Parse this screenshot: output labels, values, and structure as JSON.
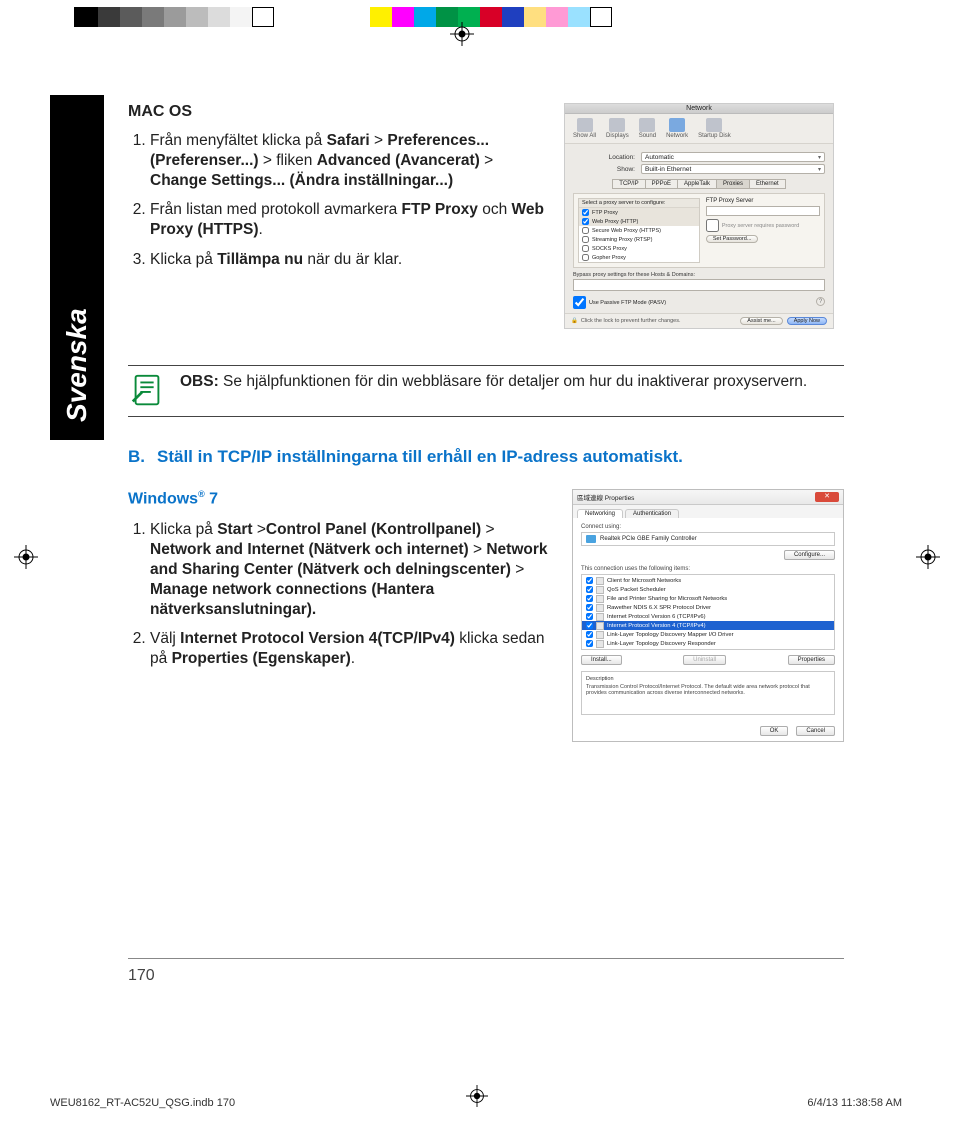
{
  "sidebar": {
    "language": "Svenska"
  },
  "macSection": {
    "heading": "MAC OS",
    "step1_a": "Från menyfältet klicka på ",
    "step1_b1": "Safari",
    "step1_gt1": " > ",
    "step1_b2": "Preferences... (Preferenser...)",
    "step1_gt2": " > fliken ",
    "step1_b3": "Advanced (Avancerat)",
    "step1_gt3": " > ",
    "step1_b4": "Change  Settings... (Ändra inställningar...)",
    "step2_a": "Från listan med protokoll avmarkera ",
    "step2_b1": "FTP Proxy",
    "step2_mid": " och ",
    "step2_b2": "Web Proxy (HTTPS)",
    "step2_p": ".",
    "step3_a": "Klicka på ",
    "step3_b": "Tillämpa nu",
    "step3_c": " när du är klar."
  },
  "macShot": {
    "title": "Network",
    "toolbar": [
      "Show All",
      "Displays",
      "Sound",
      "Network",
      "Startup Disk"
    ],
    "locLabel": "Location:",
    "locValue": "Automatic",
    "showLabel": "Show:",
    "showValue": "Built-in Ethernet",
    "tabs": [
      "TCP/IP",
      "PPPoE",
      "AppleTalk",
      "Proxies",
      "Ethernet"
    ],
    "leftHeader": "Select a proxy server to configure:",
    "proxies": [
      "FTP Proxy",
      "Web Proxy (HTTP)",
      "Secure Web Proxy (HTTPS)",
      "Streaming Proxy (RTSP)",
      "SOCKS Proxy",
      "Gopher Proxy"
    ],
    "rightTitle": "FTP Proxy Server",
    "reqPwd": "Proxy server requires password",
    "setPwd": "Set Password...",
    "bypassLabel": "Bypass proxy settings for these Hosts & Domains:",
    "pasv": "Use Passive FTP Mode (PASV)",
    "lockText": "Click the lock to prevent further changes.",
    "assist": "Assist me...",
    "apply": "Apply Now"
  },
  "note": {
    "label": "OBS:",
    "text": "   Se hjälpfunktionen för din webbläsare för detaljer om hur du inaktiverar proxyservern."
  },
  "sectionB": {
    "label": "B.",
    "title": "Ställ in TCP/IP inställningarna till erhåll en IP-adress automatiskt."
  },
  "winSection": {
    "heading_a": "Windows",
    "heading_b": " 7",
    "step1_a": "Klicka på ",
    "step1_b1": "Start",
    "step1_gt1": " >",
    "step1_b2": "Control Panel (Kontrollpanel)",
    "step1_gt2": " > ",
    "step1_b3": "Network and Internet (Nätverk och internet)",
    "step1_gt3": " > ",
    "step1_b4": "Network and Sharing Center (Nätverk och delningscenter)",
    "step1_gt4": " > ",
    "step1_b5": "Manage network connections (Hantera",
    "step1_b5b": "nätverksanslutningar).",
    "step2_a": "Välj ",
    "step2_b1": "Internet Protocol Version 4(TCP/IPv4)",
    "step2_mid": " klicka sedan på ",
    "step2_b2": "Properties (Egenskaper)",
    "step2_p": "."
  },
  "winShot": {
    "title": "區域連線 Properties",
    "tabs": [
      "Networking",
      "Authentication"
    ],
    "connect": "Connect using:",
    "adapter": "Realtek PCIe GBE Family Controller",
    "configure": "Configure...",
    "itemsLabel": "This connection uses the following items:",
    "items": [
      "Client for Microsoft Networks",
      "QoS Packet Scheduler",
      "File and Printer Sharing for Microsoft Networks",
      "Rawether NDIS 6.X SPR Protocol Driver",
      "Internet Protocol Version 6 (TCP/IPv6)",
      "Internet Protocol Version 4 (TCP/IPv4)",
      "Link-Layer Topology Discovery Mapper I/O Driver",
      "Link-Layer Topology Discovery Responder"
    ],
    "install": "Install...",
    "uninstall": "Uninstall",
    "properties": "Properties",
    "descLabel": "Description",
    "descText": "Transmission Control Protocol/Internet Protocol. The default wide area network protocol that provides communication across diverse interconnected networks.",
    "ok": "OK",
    "cancel": "Cancel"
  },
  "page": {
    "number": "170"
  },
  "printFoot": {
    "left": "WEU8162_RT-AC52U_QSG.indb   170",
    "right": "6/4/13   11:38:58 AM"
  }
}
